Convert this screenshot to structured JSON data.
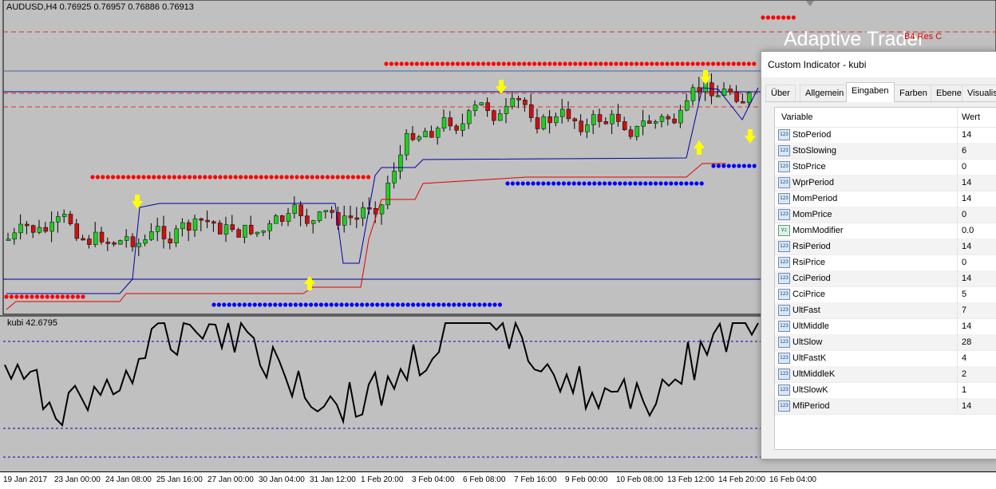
{
  "chart": {
    "symbol_title": "AUDUSD,H4  0.76925 0.76957 0.76886 0.76913",
    "subwindow_title": "kubi 42.6795",
    "watermark": "Adaptive Trader",
    "res_label": "B4 Res C",
    "colors": {
      "background": "#c0c0c0",
      "bull_candle": "#22cc22",
      "bear_candle": "#cc1111",
      "resistance_dots": "#ff0000",
      "support_dots": "#0000ff",
      "oscillator": "#000000",
      "arrow": "#ffff00"
    },
    "time_labels": [
      "19 Jan 2017",
      "23 Jan 00:00",
      "24 Jan 08:00",
      "25 Jan 16:00",
      "27 Jan 00:00",
      "30 Jan 04:00",
      "31 Jan 12:00",
      "1 Feb 20:00",
      "3 Feb 04:00",
      "6 Feb 08:00",
      "7 Feb 16:00",
      "9 Feb 00:00",
      "10 Feb 08:00",
      "13 Feb 12:00",
      "14 Feb 20:00",
      "16 Feb 04:00"
    ]
  },
  "dialog": {
    "title": "Custom Indicator - kubi",
    "tabs": [
      "Über",
      "Allgemein",
      "Eingaben",
      "Farben",
      "Ebene",
      "Visualisi"
    ],
    "active_tab": "Eingaben",
    "col_variable": "Variable",
    "col_value": "Wert",
    "rows": [
      {
        "icon": "123",
        "name": "StoPeriod",
        "value": "14"
      },
      {
        "icon": "123",
        "name": "StoSlowing",
        "value": "6"
      },
      {
        "icon": "123",
        "name": "StoPrice",
        "value": "0"
      },
      {
        "icon": "123",
        "name": "WprPeriod",
        "value": "14"
      },
      {
        "icon": "123",
        "name": "MomPeriod",
        "value": "14"
      },
      {
        "icon": "123",
        "name": "MomPrice",
        "value": "0"
      },
      {
        "icon": "Vz",
        "name": "MomModifier",
        "value": "0.0"
      },
      {
        "icon": "123",
        "name": "RsiPeriod",
        "value": "14"
      },
      {
        "icon": "123",
        "name": "RsiPrice",
        "value": "0"
      },
      {
        "icon": "123",
        "name": "CciPeriod",
        "value": "14"
      },
      {
        "icon": "123",
        "name": "CciPrice",
        "value": "5"
      },
      {
        "icon": "123",
        "name": "UltFast",
        "value": "7"
      },
      {
        "icon": "123",
        "name": "UltMiddle",
        "value": "14"
      },
      {
        "icon": "123",
        "name": "UltSlow",
        "value": "28"
      },
      {
        "icon": "123",
        "name": "UltFastK",
        "value": "4"
      },
      {
        "icon": "123",
        "name": "UltMiddleK",
        "value": "2"
      },
      {
        "icon": "123",
        "name": "UltSlowK",
        "value": "1"
      },
      {
        "icon": "123",
        "name": "MfiPeriod",
        "value": "14"
      }
    ]
  }
}
